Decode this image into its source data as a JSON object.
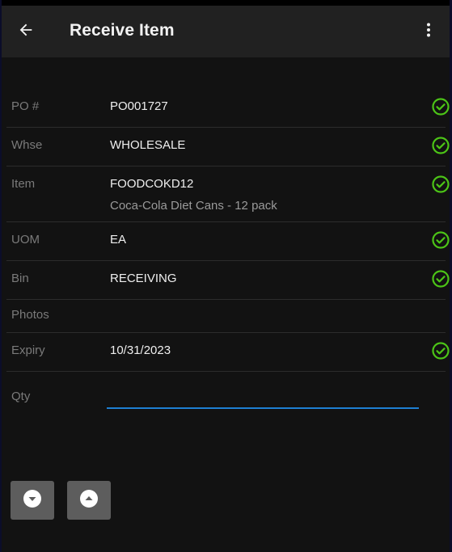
{
  "app_bar": {
    "title": "Receive Item",
    "back_icon": "arrow-left-icon",
    "menu_icon": "more-vert-icon"
  },
  "fields": [
    {
      "label": "PO #",
      "value": "PO001727",
      "validated": true
    },
    {
      "label": "Whse",
      "value": "WHOLESALE",
      "validated": true
    },
    {
      "label": "Item",
      "value": "FOODCOKD12",
      "description": "Coca-Cola Diet Cans - 12 pack",
      "validated": true
    },
    {
      "label": "UOM",
      "value": "EA",
      "validated": true
    },
    {
      "label": "Bin",
      "value": "RECEIVING",
      "validated": true
    },
    {
      "label": "Photos",
      "value": "",
      "validated": false
    },
    {
      "label": "Expiry",
      "value": "10/31/2023",
      "validated": true
    }
  ],
  "qty": {
    "label": "Qty",
    "value": "",
    "placeholder": ""
  },
  "nav_buttons": {
    "down_icon": "chevron-circle-down-icon",
    "up_icon": "chevron-circle-up-icon"
  },
  "colors": {
    "valid_check": "#4cc417",
    "input_underline": "#1e7fd2",
    "app_bar_bg": "#212121",
    "screen_bg": "#121212",
    "nav_button_bg": "#5d5d5d"
  }
}
